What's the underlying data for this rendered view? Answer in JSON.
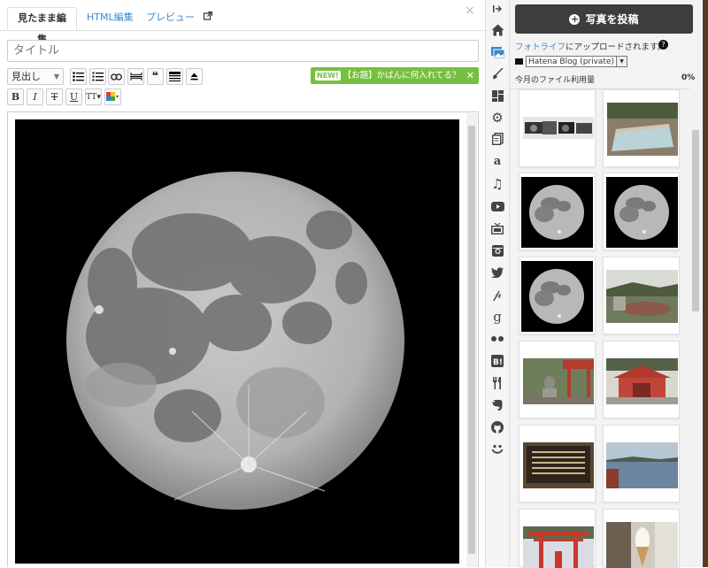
{
  "tabs": {
    "wysiwyg": "見たまま編集",
    "html": "HTML編集",
    "preview": "プレビュー"
  },
  "editor": {
    "title_placeholder": "タイトル",
    "heading_select": "見出し",
    "news_badge": "NEW!",
    "news_text": "【お題】かばんに何入れてる？"
  },
  "panel": {
    "upload_button": "写真を投稿",
    "upload_note_link": "フォトライフ",
    "upload_note_rest": "にアップロードされます。",
    "blog_select": "Hatena Blog (private)",
    "usage_label": "今月のファイル利用量",
    "usage_value": "0%"
  },
  "photos": [
    "cameras",
    "hot-spring-bath",
    "moon",
    "moon",
    "moon",
    "garden",
    "statue",
    "shrine",
    "signboard",
    "lake",
    "torii",
    "soft-serve"
  ],
  "rail_icons": [
    "collapse-icon",
    "home-icon",
    "photo-icon",
    "brush-icon",
    "layout-icon",
    "gear-icon",
    "copy-icon",
    "amazon-icon",
    "music-icon",
    "youtube-icon",
    "tv-icon",
    "instagram-icon",
    "twitter-icon",
    "pinterest-icon",
    "google-icon",
    "flickr-icon",
    "hatena-bookmark-icon",
    "food-icon",
    "evernote-icon",
    "github-icon",
    "smile-icon"
  ]
}
